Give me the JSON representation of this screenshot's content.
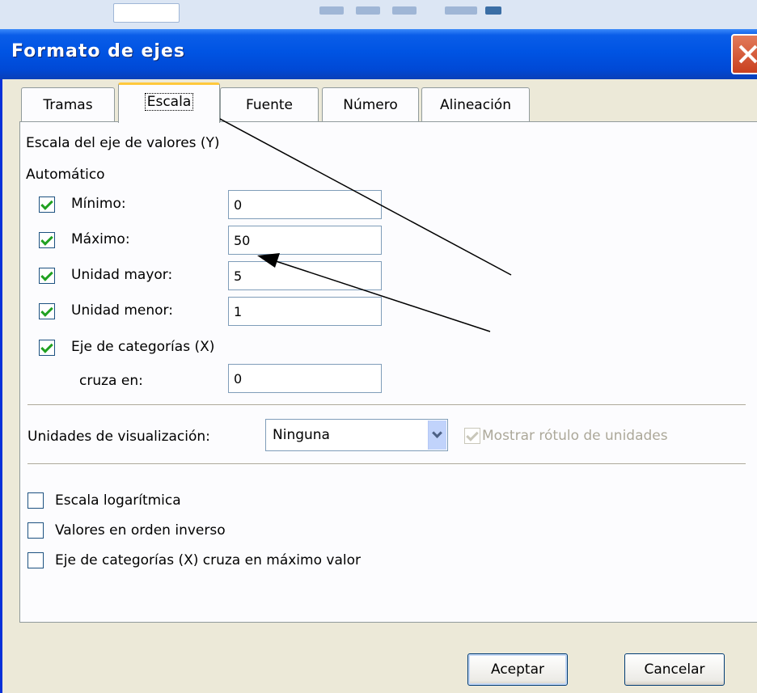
{
  "window": {
    "title": "Formato de ejes"
  },
  "tabs": [
    {
      "label": "Tramas",
      "active": false
    },
    {
      "label": "Escala",
      "active": true
    },
    {
      "label": "Fuente",
      "active": false
    },
    {
      "label": "Número",
      "active": false
    },
    {
      "label": "Alineación",
      "active": false
    }
  ],
  "scale": {
    "heading": "Escala del eje de valores (Y)",
    "auto_label": "Automático",
    "rows": [
      {
        "label": "Mínimo:",
        "checked": true,
        "value": "0"
      },
      {
        "label": "Máximo:",
        "checked": true,
        "value": "50"
      },
      {
        "label": "Unidad mayor:",
        "checked": true,
        "value": "5"
      },
      {
        "label": "Unidad menor:",
        "checked": true,
        "value": "1"
      }
    ],
    "cross": {
      "label": "Eje de categorías (X)",
      "checked": true,
      "sub_label": "cruza en:",
      "value": "0"
    }
  },
  "display_units": {
    "label": "Unidades de visualización:",
    "selected": "Ninguna",
    "show_label": {
      "text": "Mostrar rótulo de unidades",
      "checked": true,
      "disabled": true
    }
  },
  "options": [
    {
      "label": "Escala logarítmica",
      "checked": false
    },
    {
      "label": "Valores en orden inverso",
      "checked": false
    },
    {
      "label": "Eje de categorías (X) cruza en máximo valor",
      "checked": false
    }
  ],
  "buttons": {
    "ok": "Aceptar",
    "cancel": "Cancelar"
  },
  "colors": {
    "titlebar": "#0054e3",
    "active_tab_accent": "#ffc83c",
    "check": "#21a121"
  }
}
